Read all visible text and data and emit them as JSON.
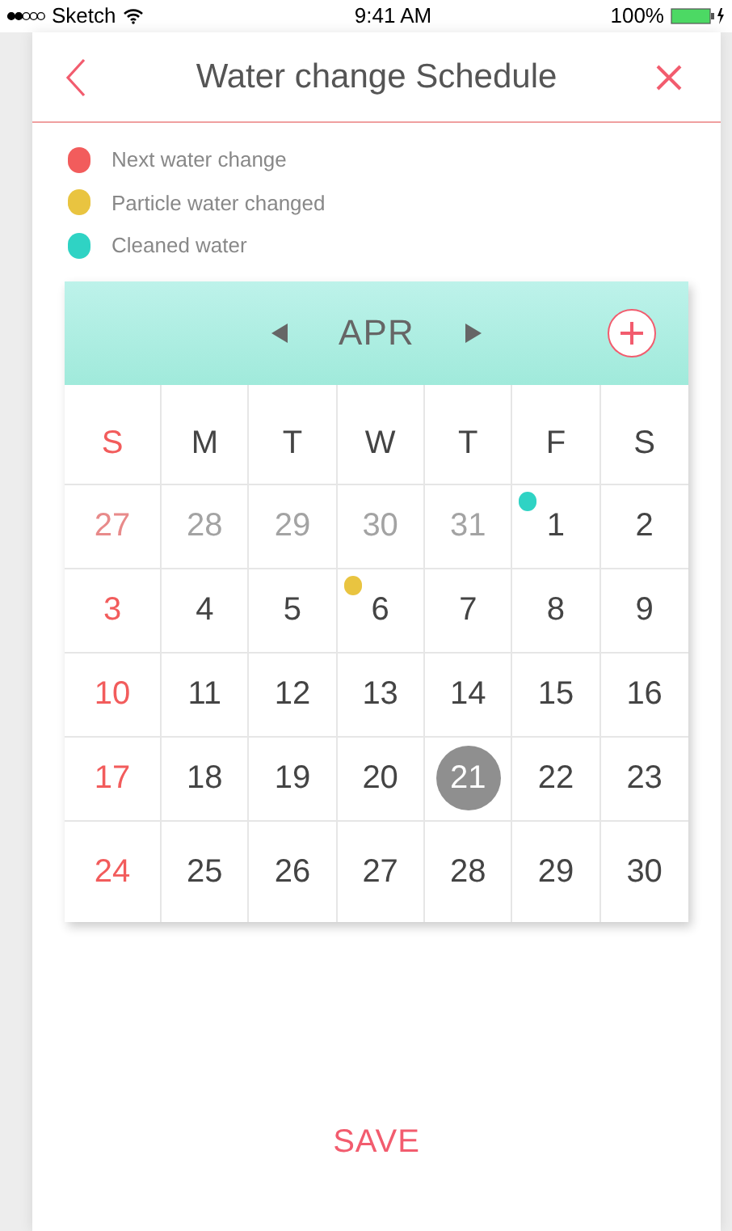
{
  "status_bar": {
    "carrier": "Sketch",
    "time": "9:41 AM",
    "battery": "100%"
  },
  "nav": {
    "title": "Water change Schedule"
  },
  "legend": [
    {
      "label": "Next water change",
      "color": "#f25c5c"
    },
    {
      "label": "Particle water changed",
      "color": "#e9c440"
    },
    {
      "label": "Cleaned water",
      "color": "#2fd3c4"
    }
  ],
  "calendar": {
    "month": "APR",
    "weekdays": [
      "S",
      "M",
      "T",
      "W",
      "T",
      "F",
      "S"
    ],
    "weeks": [
      [
        {
          "day": "27",
          "outside": true,
          "selected": false
        },
        {
          "day": "28",
          "outside": true,
          "selected": false
        },
        {
          "day": "29",
          "outside": true,
          "selected": false
        },
        {
          "day": "30",
          "outside": true,
          "selected": false
        },
        {
          "day": "31",
          "outside": true,
          "selected": false
        },
        {
          "day": "1",
          "outside": false,
          "selected": false,
          "color": "#2fd3c4"
        },
        {
          "day": "2",
          "outside": false,
          "selected": false
        }
      ],
      [
        {
          "day": "3",
          "outside": false,
          "selected": false
        },
        {
          "day": "4",
          "outside": false,
          "selected": false
        },
        {
          "day": "5",
          "outside": false,
          "selected": false
        },
        {
          "day": "6",
          "outside": false,
          "selected": false,
          "color": "#e9c440"
        },
        {
          "day": "7",
          "outside": false,
          "selected": false
        },
        {
          "day": "8",
          "outside": false,
          "selected": false
        },
        {
          "day": "9",
          "outside": false,
          "selected": false
        }
      ],
      [
        {
          "day": "10",
          "outside": false,
          "selected": false
        },
        {
          "day": "11",
          "outside": false,
          "selected": false
        },
        {
          "day": "12",
          "outside": false,
          "selected": false
        },
        {
          "day": "13",
          "outside": false,
          "selected": false
        },
        {
          "day": "14",
          "outside": false,
          "selected": false
        },
        {
          "day": "15",
          "outside": false,
          "selected": false
        },
        {
          "day": "16",
          "outside": false,
          "selected": false
        }
      ],
      [
        {
          "day": "17",
          "outside": false,
          "selected": false
        },
        {
          "day": "18",
          "outside": false,
          "selected": false
        },
        {
          "day": "19",
          "outside": false,
          "selected": false
        },
        {
          "day": "20",
          "outside": false,
          "selected": false
        },
        {
          "day": "21",
          "outside": false,
          "selected": true
        },
        {
          "day": "22",
          "outside": false,
          "selected": false
        },
        {
          "day": "23",
          "outside": false,
          "selected": false
        }
      ],
      [
        {
          "day": "24",
          "outside": false,
          "selected": false
        },
        {
          "day": "25",
          "outside": false,
          "selected": false
        },
        {
          "day": "26",
          "outside": false,
          "selected": false
        },
        {
          "day": "27",
          "outside": false,
          "selected": false
        },
        {
          "day": "28",
          "outside": false,
          "selected": false
        },
        {
          "day": "29",
          "outside": false,
          "selected": false
        },
        {
          "day": "30",
          "outside": false,
          "selected": false
        }
      ]
    ]
  },
  "save_button": "SAVE"
}
